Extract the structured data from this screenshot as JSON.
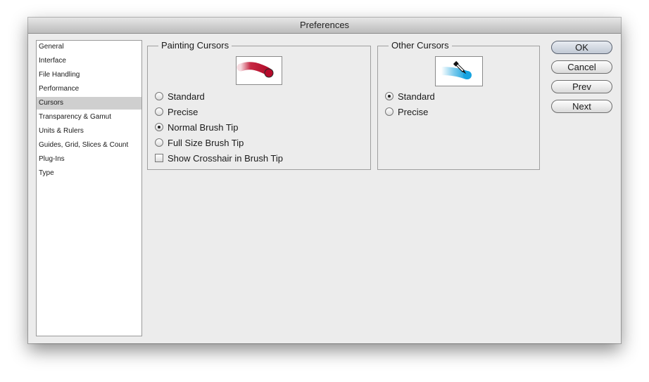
{
  "window": {
    "title": "Preferences"
  },
  "sidebar": {
    "items": [
      {
        "label": "General"
      },
      {
        "label": "Interface"
      },
      {
        "label": "File Handling"
      },
      {
        "label": "Performance"
      },
      {
        "label": "Cursors",
        "selected": true
      },
      {
        "label": "Transparency & Gamut"
      },
      {
        "label": "Units & Rulers"
      },
      {
        "label": "Guides, Grid, Slices & Count"
      },
      {
        "label": "Plug-Ins"
      },
      {
        "label": "Type"
      }
    ]
  },
  "painting_cursors": {
    "title": "Painting Cursors",
    "preview_icon": "brush-stroke-icon",
    "options": [
      {
        "label": "Standard",
        "type": "radio",
        "checked": false
      },
      {
        "label": "Precise",
        "type": "radio",
        "checked": false
      },
      {
        "label": "Normal Brush Tip",
        "type": "radio",
        "checked": true
      },
      {
        "label": "Full Size Brush Tip",
        "type": "radio",
        "checked": false
      },
      {
        "label": "Show Crosshair in Brush Tip",
        "type": "checkbox",
        "checked": false
      }
    ]
  },
  "other_cursors": {
    "title": "Other Cursors",
    "preview_icon": "eyedropper-icon",
    "options": [
      {
        "label": "Standard",
        "type": "radio",
        "checked": true
      },
      {
        "label": "Precise",
        "type": "radio",
        "checked": false
      }
    ]
  },
  "buttons": {
    "ok": "OK",
    "cancel": "Cancel",
    "prev": "Prev",
    "next": "Next"
  },
  "colors": {
    "brush_stroke": "#c0102e",
    "eyedropper_tip": "#1fa6e0",
    "selected_item_bg": "#cfcfcf"
  }
}
